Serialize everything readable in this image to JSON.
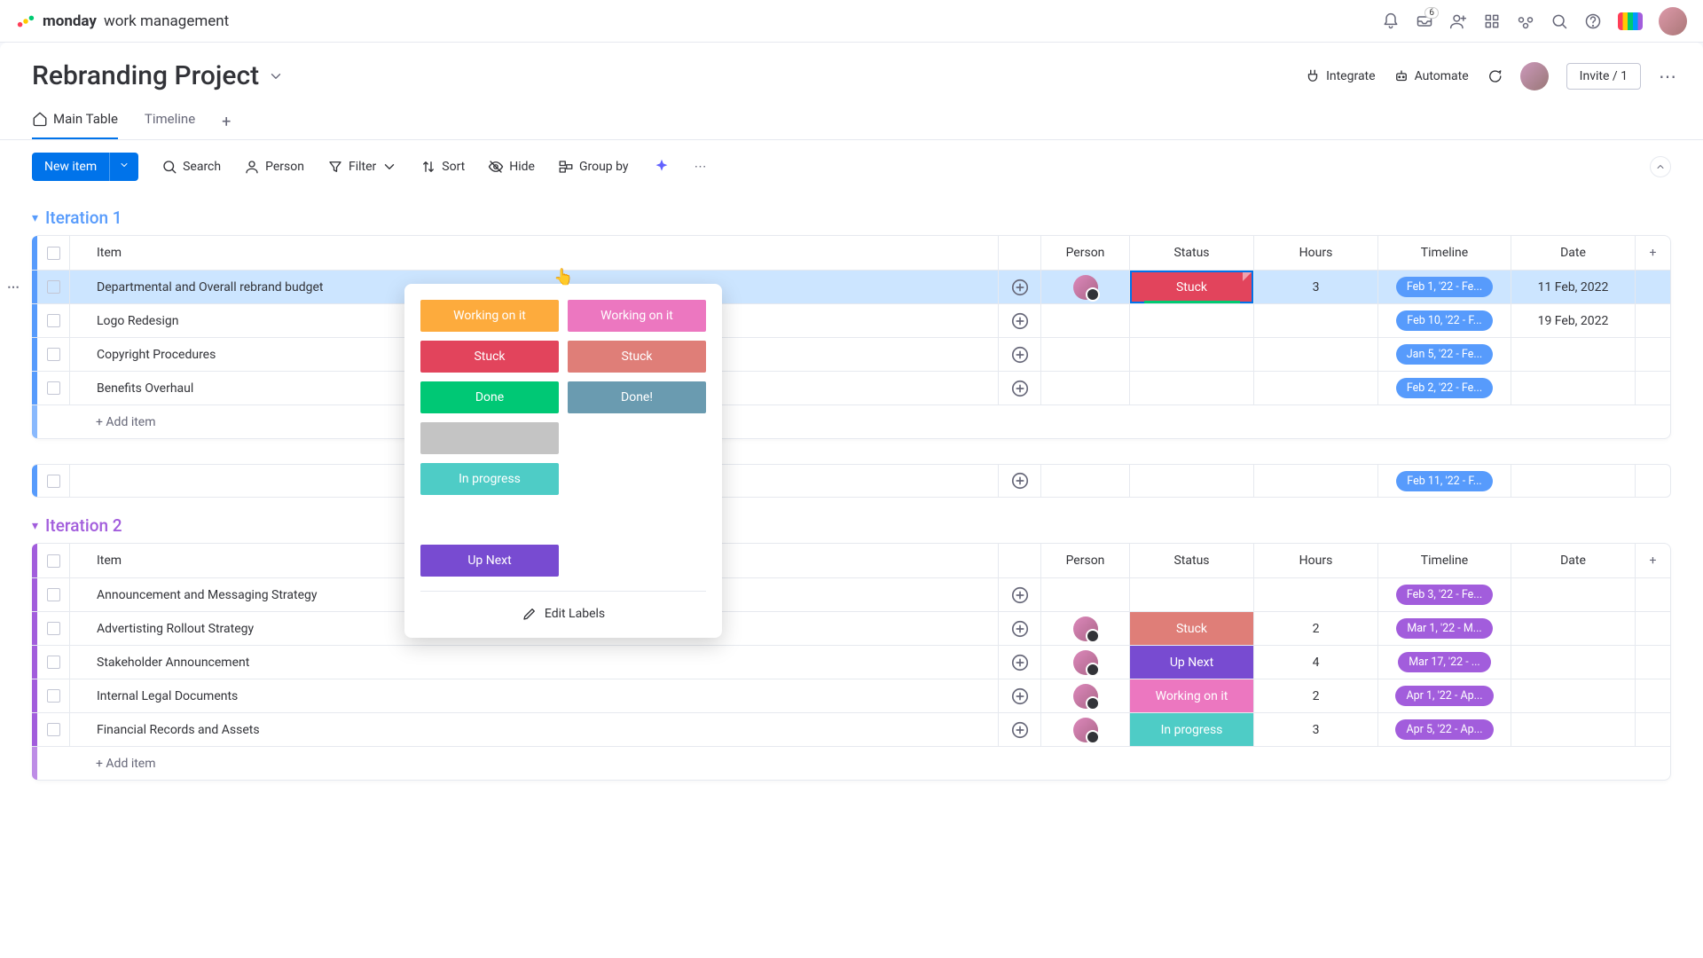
{
  "brand": {
    "strong": "monday",
    "rest": "work management"
  },
  "notification_badge": "6",
  "board_title": "Rebranding Project",
  "header": {
    "integrate": "Integrate",
    "automate": "Automate",
    "invite": "Invite / 1"
  },
  "tabs": {
    "main": "Main Table",
    "timeline": "Timeline"
  },
  "toolbar": {
    "new_item": "New item",
    "search": "Search",
    "person": "Person",
    "filter": "Filter",
    "sort": "Sort",
    "hide": "Hide",
    "group_by": "Group by"
  },
  "columns": {
    "item": "Item",
    "person": "Person",
    "status": "Status",
    "hours": "Hours",
    "timeline": "Timeline",
    "date": "Date"
  },
  "add_item": "+ Add item",
  "groups": {
    "iter1": {
      "name": "Iteration 1",
      "rows": [
        {
          "item": "Departmental and Overall rebrand budget",
          "status": "Stuck",
          "status_color": "#e2445c",
          "status_editing": true,
          "hours": "3",
          "timeline": "Feb 1, '22 - Fe...",
          "date": "11 Feb, 2022",
          "person": true,
          "selected": true
        },
        {
          "item": "Logo Redesign",
          "status": "",
          "status_color": "",
          "hours": "",
          "timeline": "Feb 10, '22 - F...",
          "date": "19 Feb, 2022",
          "person": false
        },
        {
          "item": "Copyright Procedures",
          "status": "",
          "status_color": "",
          "hours": "",
          "timeline": "Jan 5, '22 - Fe...",
          "date": "",
          "person": false
        },
        {
          "item": "Benefits Overhaul",
          "status": "",
          "status_color": "",
          "hours": "",
          "timeline": "Feb 2, '22 - Fe...",
          "date": "",
          "person": false
        }
      ]
    },
    "orphan": {
      "timeline": "Feb 11, '22 - F..."
    },
    "iter2": {
      "name": "Iteration 2",
      "rows": [
        {
          "item": "Announcement and Messaging Strategy",
          "status": "",
          "status_color": "",
          "hours": "",
          "timeline": "Feb 3, '22 - Fe...",
          "date": "",
          "person": false
        },
        {
          "item": "Advertisting Rollout Strategy",
          "status": "Stuck",
          "status_color": "#df7e78",
          "hours": "2",
          "timeline": "Mar 1, '22 - M...",
          "date": "",
          "person": true
        },
        {
          "item": "Stakeholder Announcement",
          "status": "Up Next",
          "status_color": "#784bd1",
          "hours": "4",
          "timeline": "Mar 17, '22 - ...",
          "date": "",
          "person": true
        },
        {
          "item": "Internal Legal Documents",
          "status": "Working on it",
          "status_color": "#ec77c0",
          "hours": "2",
          "timeline": "Apr 1, '22 - Ap...",
          "date": "",
          "person": true
        },
        {
          "item": "Financial Records and Assets",
          "status": "In progress",
          "status_color": "#4eccc6",
          "hours": "3",
          "timeline": "Apr 5, '22 - Ap...",
          "date": "",
          "person": true
        }
      ]
    }
  },
  "status_dropdown": {
    "options": [
      {
        "label": "Working on it",
        "color": "#fdab3d"
      },
      {
        "label": "Working on it",
        "color": "#ec77c0"
      },
      {
        "label": "Stuck",
        "color": "#e2445c"
      },
      {
        "label": "Stuck",
        "color": "#df7e78"
      },
      {
        "label": "Done",
        "color": "#00c875"
      },
      {
        "label": "Done!",
        "color": "#6a9bb0"
      },
      {
        "label": "",
        "color": "#c4c4c4"
      },
      {
        "label": "",
        "color": ""
      },
      {
        "label": "In progress",
        "color": "#4eccc6"
      },
      {
        "label": "",
        "color": ""
      },
      {
        "label": "Up Next",
        "color": "#784bd1"
      }
    ],
    "edit_labels": "Edit Labels"
  }
}
